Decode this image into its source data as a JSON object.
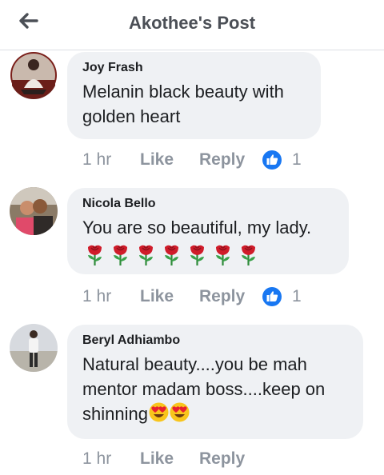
{
  "header": {
    "title": "Akothee's Post",
    "back_icon": "back-arrow-icon"
  },
  "comments": [
    {
      "author": "Joy Frash",
      "lines": [
        "Melanin black beauty with",
        "golden heart"
      ],
      "time": "1 hr",
      "like": "Like",
      "reply": "Reply",
      "reactions": "1"
    },
    {
      "author": "Nicola Bello",
      "lines": [
        "You are so beautiful, my lady."
      ],
      "emoji": "rose x7",
      "time": "1 hr",
      "like": "Like",
      "reply": "Reply",
      "reactions": "1"
    },
    {
      "author": "Beryl Adhiambo",
      "lines": [
        "Natural beauty....you be mah",
        "mentor madam boss....keep on",
        "shinning"
      ],
      "emoji": "heart-eyes x2",
      "time": "1 hr",
      "like": "Like",
      "reply": "Reply"
    }
  ],
  "colors": {
    "reaction_blue": "#1877f2",
    "bubble": "#eff1f4",
    "meta": "#8d949e"
  }
}
